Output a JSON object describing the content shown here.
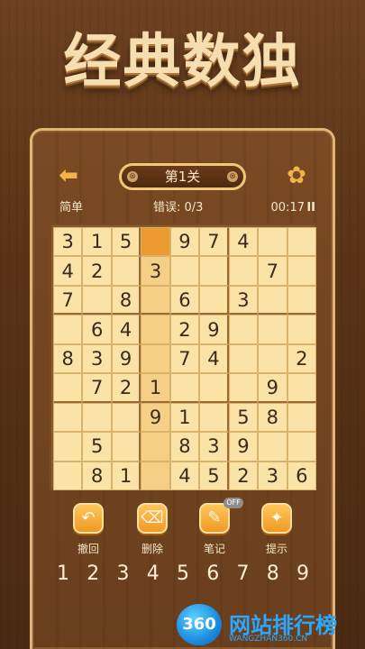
{
  "headline": "经典数独",
  "header": {
    "back_icon": "arrow-left-icon",
    "level_label": "第1关",
    "pill_left": "⊗",
    "pill_right": "⊗",
    "settings_icon": "gear-icon"
  },
  "status": {
    "difficulty": "简单",
    "errors": "错误: 0/3",
    "timer": "00:17",
    "pause": "II"
  },
  "board": {
    "rows": [
      [
        "3",
        "1",
        "5",
        "",
        "9",
        "7",
        "4",
        "",
        ""
      ],
      [
        "4",
        "2",
        "",
        "3",
        "",
        "",
        "",
        "7",
        ""
      ],
      [
        "7",
        "",
        "8",
        "",
        "6",
        "",
        "3",
        "",
        ""
      ],
      [
        "",
        "6",
        "4",
        "",
        "2",
        "9",
        "",
        "",
        ""
      ],
      [
        "8",
        "3",
        "9",
        "",
        "7",
        "4",
        "",
        "",
        "2"
      ],
      [
        "",
        "7",
        "2",
        "1",
        "",
        "",
        "",
        "9",
        ""
      ],
      [
        "",
        "",
        "",
        "9",
        "1",
        "",
        "5",
        "8",
        ""
      ],
      [
        "",
        "5",
        "",
        "",
        "8",
        "3",
        "9",
        "",
        ""
      ],
      [
        "",
        "8",
        "1",
        "",
        "4",
        "5",
        "2",
        "3",
        "6"
      ]
    ],
    "selected": {
      "row": 0,
      "col": 3
    },
    "colors": {
      "cell": "#fbe3a8",
      "highlight": "#f5cf87",
      "selected": "#ea9a2e"
    }
  },
  "tools": [
    {
      "label": "撤回",
      "icon": "undo-icon",
      "glyph": "↶"
    },
    {
      "label": "删除",
      "icon": "eraser-icon",
      "glyph": "⌫"
    },
    {
      "label": "笔记",
      "icon": "pencil-icon",
      "glyph": "✎",
      "badge": "OFF"
    },
    {
      "label": "提示",
      "icon": "lightbulb-icon",
      "glyph": "✦"
    }
  ],
  "numpad": [
    "1",
    "2",
    "3",
    "4",
    "5",
    "6",
    "7",
    "8",
    "9"
  ],
  "watermark": {
    "logo": "360",
    "text": "网站排行榜",
    "url": "WANGZHAN360.CN"
  }
}
